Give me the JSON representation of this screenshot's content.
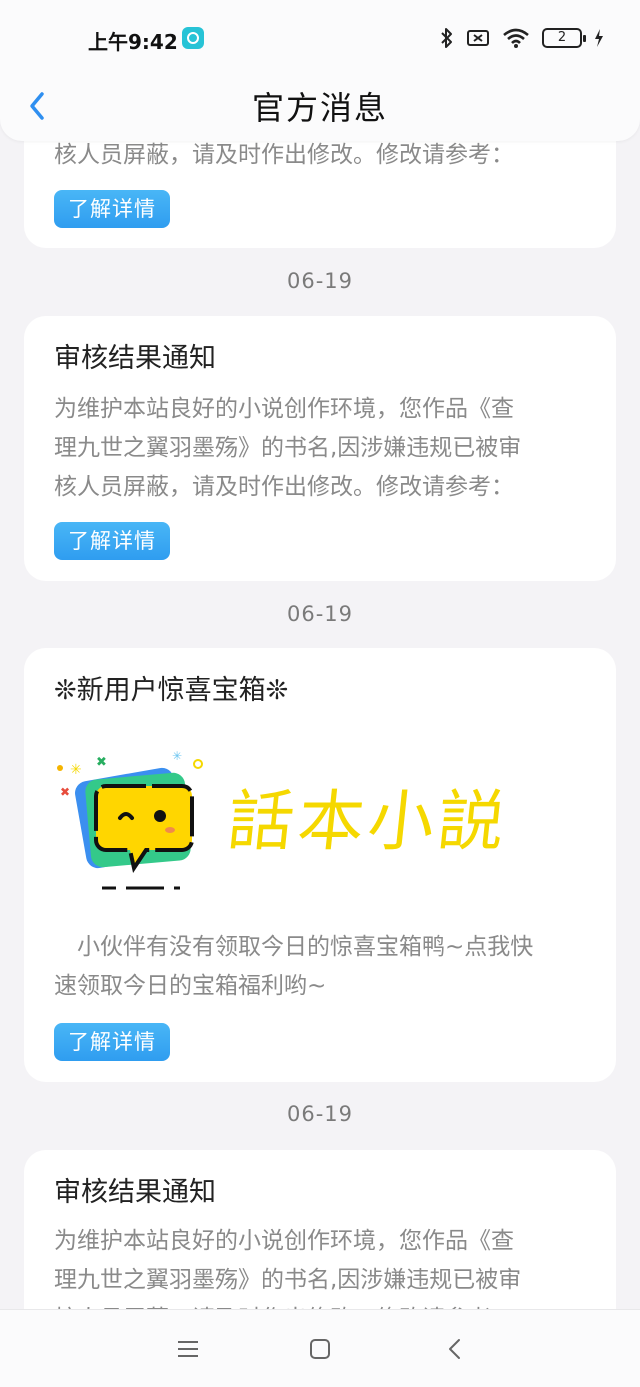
{
  "status_bar": {
    "time": "上午9:42",
    "battery": "2"
  },
  "header": {
    "title": "官方消息"
  },
  "messages": [
    {
      "body_tail": "核人员屏蔽，请及时作出修改。修改请参考：",
      "button": "了解详情"
    },
    {
      "date": "06-19",
      "title": "审核结果通知",
      "body": [
        "为维护本站良好的小说创作环境，您作品《查",
        "理九世之翼羽墨殇》的书名,因涉嫌违规已被审",
        "核人员屏蔽，请及时作出修改。修改请参考："
      ],
      "button": "了解详情"
    },
    {
      "date": "06-19",
      "title": "❊新用户惊喜宝箱❊",
      "banner_text": "話本小説",
      "body": [
        "　小伙伴有没有领取今日的惊喜宝箱鸭~点我快",
        "速领取今日的宝箱福利哟~"
      ],
      "button": "了解详情"
    },
    {
      "date": "06-19",
      "title": "审核结果通知",
      "body": [
        "为维护本站良好的小说创作环境，您作品《查",
        "理九世之翼羽墨殇》的书名,因涉嫌违规已被审",
        "核人员屏蔽，请及时作出修改。修改请参考："
      ]
    }
  ],
  "colors": {
    "accent_button": "#3aa8f3",
    "background": "#f4f3f6",
    "logo_yellow": "#f5d800"
  }
}
